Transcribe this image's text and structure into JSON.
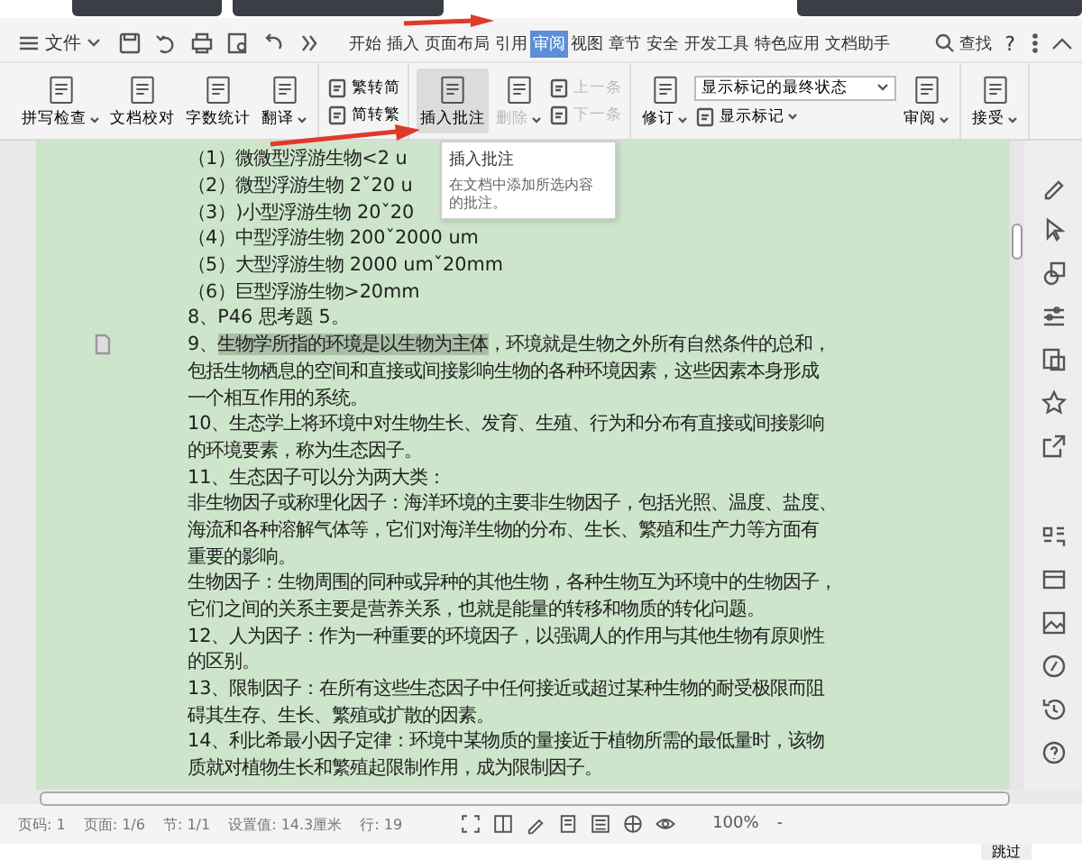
{
  "menu": {
    "file_label": "文件",
    "tabs": [
      {
        "label": "开始",
        "selected": false
      },
      {
        "label": "插入",
        "selected": false
      },
      {
        "label": "页面布局",
        "selected": false
      },
      {
        "label": "引用",
        "selected": false
      },
      {
        "label": "审阅",
        "selected": true
      },
      {
        "label": "视图",
        "selected": false
      },
      {
        "label": "章节",
        "selected": false
      },
      {
        "label": "安全",
        "selected": false
      },
      {
        "label": "开发工具",
        "selected": false
      },
      {
        "label": "特色应用",
        "selected": false
      },
      {
        "label": "文档助手",
        "selected": false
      }
    ],
    "search_label": "查找",
    "help_label": "?"
  },
  "ribbon": {
    "groups": [
      [
        {
          "kind": "large",
          "label": "拼写检查",
          "dropdown": true,
          "disabled": false,
          "pressed": false
        },
        {
          "kind": "large",
          "label": "文档校对",
          "dropdown": false,
          "disabled": false,
          "pressed": false
        },
        {
          "kind": "large",
          "label": "字数统计",
          "dropdown": false,
          "disabled": false,
          "pressed": false
        },
        {
          "kind": "large",
          "label": "翻译",
          "dropdown": true,
          "disabled": false,
          "pressed": false
        }
      ],
      [
        {
          "kind": "stack",
          "items": [
            {
              "label": "繁转简",
              "dropdown": false,
              "disabled": false
            },
            {
              "label": "简转繁",
              "dropdown": false,
              "disabled": false
            }
          ]
        }
      ],
      [
        {
          "kind": "large",
          "label": "插入批注",
          "dropdown": false,
          "disabled": false,
          "pressed": true
        },
        {
          "kind": "large",
          "label": "删除",
          "dropdown": true,
          "disabled": true,
          "pressed": false
        },
        {
          "kind": "stack",
          "items": [
            {
              "label": "上一条",
              "dropdown": false,
              "disabled": true
            },
            {
              "label": "下一条",
              "dropdown": false,
              "disabled": true
            }
          ]
        }
      ],
      [
        {
          "kind": "large",
          "label": "修订",
          "dropdown": true,
          "disabled": false,
          "pressed": false
        },
        {
          "kind": "select_stack",
          "value": "显示标记的最终状态",
          "items": [
            {
              "label": "显示标记",
              "dropdown": true,
              "disabled": false
            }
          ]
        },
        {
          "kind": "large",
          "label": "审阅",
          "dropdown": true,
          "disabled": false,
          "pressed": false
        }
      ],
      [
        {
          "kind": "large",
          "label": "接受",
          "dropdown": true,
          "disabled": false,
          "pressed": false
        }
      ]
    ]
  },
  "tooltip": {
    "title": "插入批注",
    "text": "在文档中添加所选内容的批注。"
  },
  "document": {
    "lines": [
      {
        "kind": "plain",
        "text": "（1）微微型浮游生物<2 u"
      },
      {
        "kind": "plain",
        "text": "（2）微型浮游生物 2ˇ20 u"
      },
      {
        "kind": "plain",
        "text": "（3）)小型浮游生物 20ˇ20"
      },
      {
        "kind": "plain",
        "text": "（4）中型浮游生物 200ˇ2000 um"
      },
      {
        "kind": "plain",
        "text": "（5）大型浮游生物 2000 umˇ20mm"
      },
      {
        "kind": "plain",
        "text": "（6）巨型浮游生物>20mm"
      },
      {
        "kind": "plain",
        "text": "8、P46 思考题 5。"
      },
      {
        "kind": "marked",
        "segments": [
          {
            "text": "9、",
            "highlighted": false
          },
          {
            "text": "生物学所指的环境是以生物为主体",
            "highlighted": true
          },
          {
            "text": "，环境就是生物之外所有自然条件的总和，",
            "highlighted": false
          }
        ]
      },
      {
        "kind": "plain",
        "text": "包括生物栖息的空间和直接或间接影响生物的各种环境因素，这些因素本身形成"
      },
      {
        "kind": "plain",
        "text": "一个相互作用的系统。"
      },
      {
        "kind": "plain",
        "text": "10、生态学上将环境中对生物生长、发育、生殖、行为和分布有直接或间接影响"
      },
      {
        "kind": "plain",
        "text": "的环境要素，称为生态因子。"
      },
      {
        "kind": "plain",
        "text": "11、生态因子可以分为两大类："
      },
      {
        "kind": "plain",
        "text": "非生物因子或称理化因子：海洋环境的主要非生物因子，包括光照、温度、盐度、"
      },
      {
        "kind": "plain",
        "text": "海流和各种溶解气体等，它们对海洋生物的分布、生长、繁殖和生产力等方面有"
      },
      {
        "kind": "plain",
        "text": "重要的影响。"
      },
      {
        "kind": "plain",
        "text": "生物因子：生物周围的同种或异种的其他生物，各种生物互为环境中的生物因子，"
      },
      {
        "kind": "plain",
        "text": "它们之间的关系主要是营养关系，也就是能量的转移和物质的转化问题。"
      },
      {
        "kind": "plain",
        "text": "12、人为因子：作为一种重要的环境因子，以强调人的作用与其他生物有原则性"
      },
      {
        "kind": "plain",
        "text": "的区别。"
      },
      {
        "kind": "plain",
        "text": "13、限制因子：在所有这些生态因子中任何接近或超过某种生物的耐受极限而阻"
      },
      {
        "kind": "plain",
        "text": "碍其生存、生长、繁殖或扩散的因素。"
      },
      {
        "kind": "plain",
        "text": "14、利比希最小因子定律：环境中某物质的量接近于植物所需的最低量时，该物"
      },
      {
        "kind": "plain",
        "text": "质就对植物生长和繁殖起限制作用，成为限制因子。"
      }
    ]
  },
  "status_bar": {
    "items": [
      "页码: 1",
      "页面: 1/6",
      "节: 1/1",
      "设置值: 14.3厘米",
      "行: 19"
    ],
    "zoom": "100%",
    "zoom_out": "-"
  },
  "skip_button": "跳过"
}
